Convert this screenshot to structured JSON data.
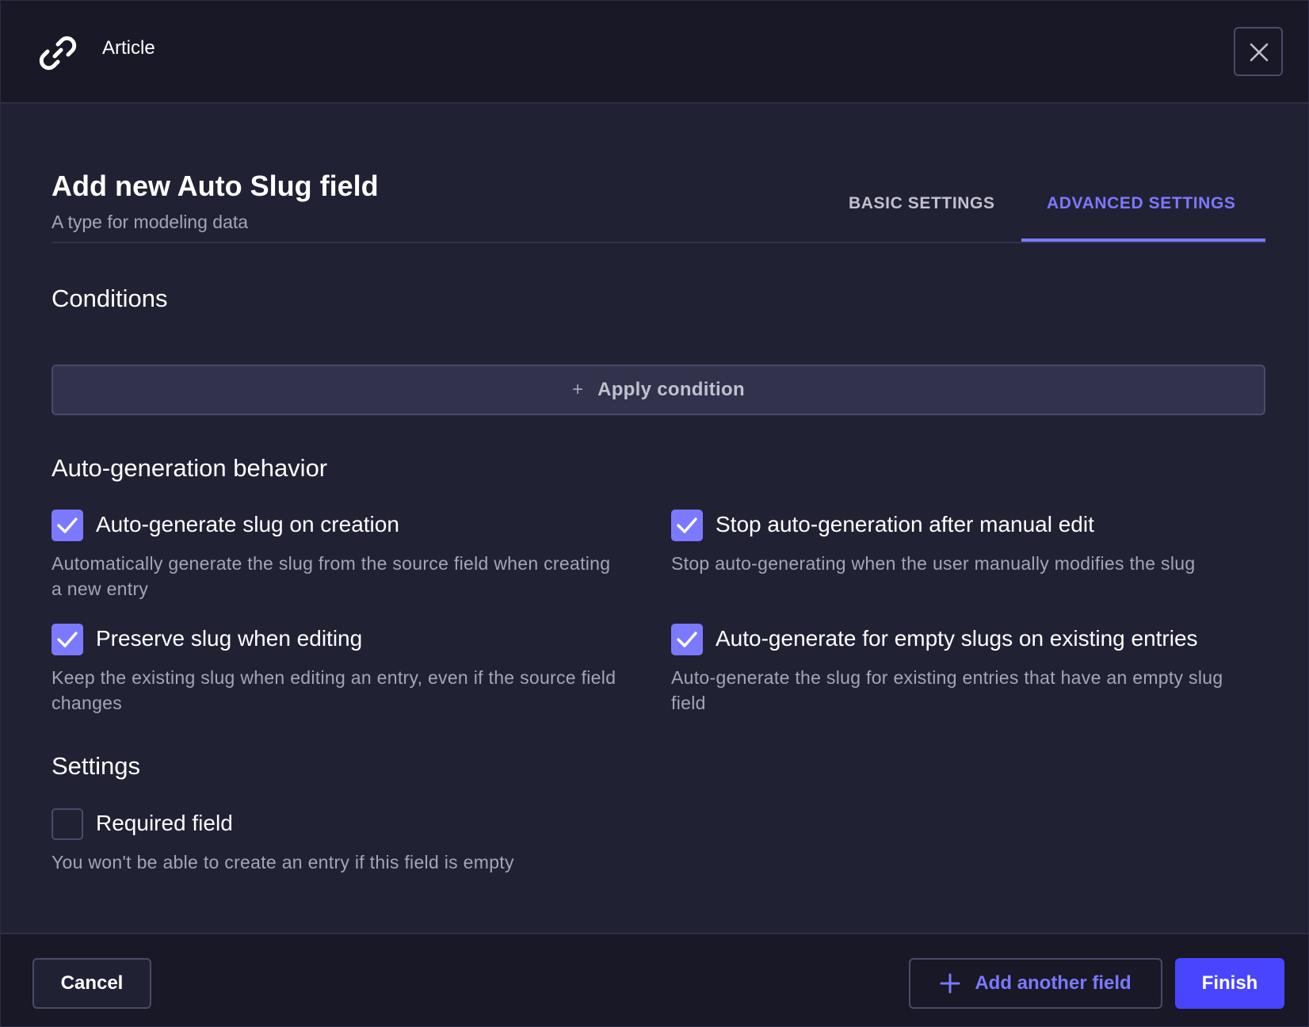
{
  "header": {
    "title": "Article",
    "icon": "link-icon",
    "close_icon": "close-icon"
  },
  "dialog": {
    "title": "Add new Auto Slug field",
    "subtitle": "A type for modeling data"
  },
  "tabs": [
    {
      "label": "BASIC SETTINGS",
      "active": false
    },
    {
      "label": "ADVANCED SETTINGS",
      "active": true
    }
  ],
  "conditions": {
    "title": "Conditions",
    "apply_label": "Apply condition",
    "apply_icon": "plus-icon"
  },
  "autogen": {
    "title": "Auto-generation behavior",
    "options": [
      {
        "label": "Auto-generate slug on creation",
        "description": "Automatically generate the slug from the source field when creating a new entry",
        "checked": true
      },
      {
        "label": "Stop auto-generation after manual edit",
        "description": "Stop auto-generating when the user manually modifies the slug",
        "checked": true
      },
      {
        "label": "Preserve slug when editing",
        "description": "Keep the existing slug when editing an entry, even if the source field changes",
        "checked": true
      },
      {
        "label": "Auto-generate for empty slugs on existing entries",
        "description": "Auto-generate the slug for existing entries that have an empty slug field",
        "checked": true
      }
    ]
  },
  "settings": {
    "title": "Settings",
    "options": [
      {
        "label": "Required field",
        "description": "You won't be able to create an entry if this field is empty",
        "checked": false
      }
    ]
  },
  "footer": {
    "cancel_label": "Cancel",
    "add_another_label": "Add another field",
    "finish_label": "Finish"
  },
  "colors": {
    "accent": "#7b79ff",
    "primary_button": "#4945ff",
    "background": "#212134",
    "header_background": "#181826"
  }
}
